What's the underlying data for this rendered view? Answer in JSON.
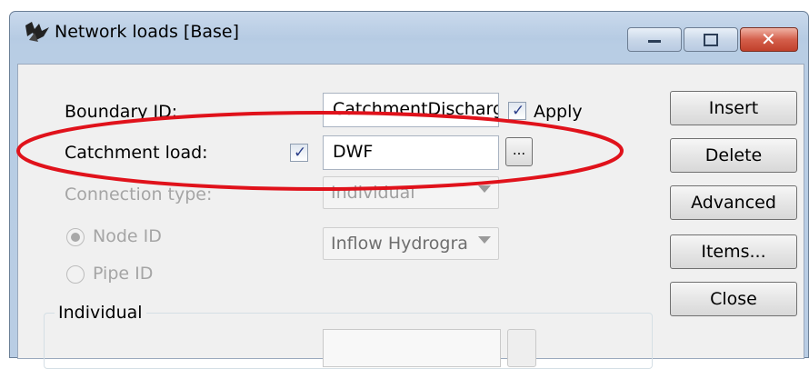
{
  "window": {
    "title": "Network loads [Base]"
  },
  "form": {
    "boundary_id_label": "Boundary ID:",
    "boundary_id_value": "CatchmentDischarg",
    "apply_label": "Apply",
    "apply_checked": true,
    "catchment_load_label": "Catchment load:",
    "catchment_load_checked": true,
    "catchment_load_value": "DWF",
    "browse_label": "...",
    "connection_type_label": "Connection type:",
    "connection_type_value": "Individual",
    "node_id_label": "Node ID",
    "node_id_selected": true,
    "inflow_value": "Inflow Hydrogra",
    "pipe_id_label": "Pipe ID",
    "individual_group_label": "Individual"
  },
  "buttons": {
    "insert": "Insert",
    "delete": "Delete",
    "advanced": "Advanced",
    "items": "Items...",
    "close": "Close"
  },
  "colors": {
    "annotation_ellipse": "#e0121b",
    "disabled_text": "#a5a5a5"
  }
}
